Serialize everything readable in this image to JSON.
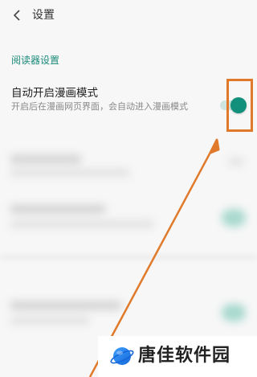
{
  "header": {
    "title": "设置",
    "back_icon": "chevron-left-icon"
  },
  "section": {
    "title": "阅读器设置"
  },
  "setting": {
    "title": "自动开启漫画模式",
    "description": "开启后在漫画网页界面，会自动进入漫画模式",
    "toggle_on": true
  },
  "colors": {
    "accent": "#12907c",
    "section_header": "#1a8a7a",
    "highlight": "#e07a2a"
  },
  "watermark": {
    "text": "唐佳软件园",
    "logo_icon": "planet-logo-icon"
  }
}
